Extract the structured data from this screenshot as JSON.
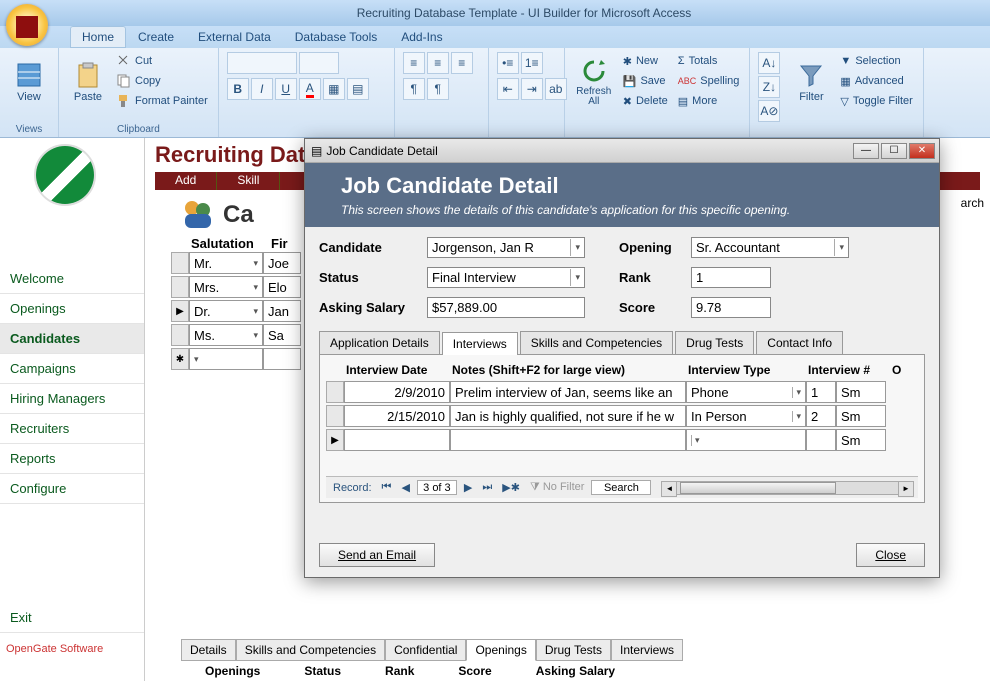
{
  "window": {
    "title": "Recruiting Database Template - UI Builder for Microsoft Access"
  },
  "ribbon": {
    "tabs": [
      "Home",
      "Create",
      "External Data",
      "Database Tools",
      "Add-Ins"
    ],
    "active": 0,
    "groups": {
      "views": "Views",
      "clipboard": "Clipboard",
      "view": "View",
      "paste": "Paste",
      "cut": "Cut",
      "copy": "Copy",
      "format_painter": "Format Painter",
      "refresh": "Refresh All",
      "records_new": "New",
      "records_save": "Save",
      "records_delete": "Delete",
      "totals": "Totals",
      "spelling": "Spelling",
      "more": "More",
      "filter": "Filter",
      "selection": "Selection",
      "advanced": "Advanced",
      "toggle_filter": "Toggle Filter"
    }
  },
  "page": {
    "title": "Recruiting Datab",
    "banner": {
      "add": "Add",
      "skill": "Skill"
    },
    "candidates_header": "Ca",
    "columns": {
      "salutation": "Salutation",
      "first": "Fir"
    },
    "rows": [
      {
        "sal": "Mr.",
        "first": "Joe"
      },
      {
        "sal": "Mrs.",
        "first": "Elo"
      },
      {
        "sal": "Dr.",
        "first": "Jan"
      },
      {
        "sal": "Ms.",
        "first": "Sa"
      }
    ],
    "bottom_tabs": [
      "Details",
      "Skills and Competencies",
      "Confidential",
      "Openings",
      "Drug Tests",
      "Interviews"
    ],
    "bottom_active": 3,
    "bottom_cols": [
      "Openings",
      "Status",
      "Rank",
      "Score",
      "Asking Salary"
    ],
    "search_label": "arch"
  },
  "nav": {
    "items": [
      "Welcome",
      "Openings",
      "Candidates",
      "Campaigns",
      "Hiring Managers",
      "Recruiters",
      "Reports",
      "Configure"
    ],
    "active": 2,
    "exit": "Exit",
    "brand": "OpenGate Software"
  },
  "dialog": {
    "title": "Job Candidate Detail",
    "heading": "Job Candidate Detail",
    "subheading": "This screen shows the details of this candidate's application for this specific opening.",
    "fields": {
      "candidate_label": "Candidate",
      "candidate": "Jorgenson, Jan R",
      "opening_label": "Opening",
      "opening": "Sr. Accountant",
      "status_label": "Status",
      "status": "Final Interview",
      "rank_label": "Rank",
      "rank": "1",
      "asking_label": "Asking Salary",
      "asking": "$57,889.00",
      "score_label": "Score",
      "score": "9.78"
    },
    "tabs": [
      "Application Details",
      "Interviews",
      "Skills and Competencies",
      "Drug Tests",
      "Contact Info"
    ],
    "tab_active": 1,
    "grid": {
      "cols": {
        "date": "Interview Date",
        "notes": "Notes (Shift+F2 for large view)",
        "type": "Interview Type",
        "num": "Interview #",
        "o": "O"
      },
      "rows": [
        {
          "date": "2/9/2010",
          "notes": "Prelim interview of Jan, seems like an",
          "type": "Phone",
          "num": "1",
          "o": "Sm"
        },
        {
          "date": "2/15/2010",
          "notes": "Jan is highly qualified, not sure if he w",
          "type": "In Person",
          "num": "2",
          "o": "Sm"
        }
      ],
      "recordnav": {
        "label": "Record:",
        "pos": "3 of 3",
        "nofilter": "No Filter",
        "search": "Search"
      }
    },
    "buttons": {
      "email": "Send an Email",
      "close": "Close"
    }
  }
}
